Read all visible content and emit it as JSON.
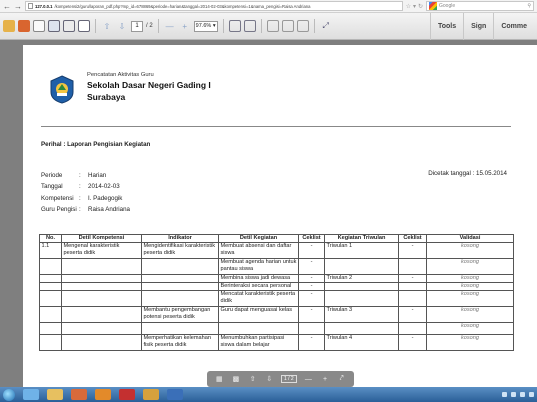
{
  "browser": {
    "url_host": "127.0.0.1",
    "url_path": "/kompetensi2/guru/laporan_pdf.php?mp_id=678869&periode=harian&tanggal=2014-02-03&kompetensi=1&nama_pengisi=Raisa Andriana",
    "search_placeholder": "Google"
  },
  "pdf_toolbar": {
    "page_current": "1",
    "page_total": "/ 2",
    "zoom": "97.6%",
    "tabs": [
      "Tools",
      "Sign",
      "Comme"
    ]
  },
  "document": {
    "header": {
      "line1": "Pencatatan Aktivitas Guru",
      "school": "Sekolah Dasar Negeri Gading I",
      "city": "Surabaya"
    },
    "perihal": "Perihal : Laporan Pengisian Kegiatan",
    "meta": [
      {
        "label": "Periode",
        "value": "Harian"
      },
      {
        "label": "Tanggal",
        "value": "2014-02-03"
      },
      {
        "label": "Kompetensi",
        "value": "I. Padegogik"
      },
      {
        "label": "Guru Pengisi",
        "value": "Raisa Andriana"
      }
    ],
    "colon": ":",
    "dicetak": "Dicetak tanggal : 15.05.2014",
    "table": {
      "headers": [
        "No.",
        "Detil Kompetensi",
        "Indikator",
        "Detil Kegiatan",
        "Ceklist",
        "Kegiatan Triwulan",
        "Ceklist",
        "Validasi"
      ],
      "rows": [
        [
          "1.1",
          "Mengenal karakteristik peserta didik",
          "Mengidentifikasi karakteristik peserta didik",
          "Membuat absensi dan daftar siswa",
          "-",
          "Triwulan 1",
          "-",
          "kosong"
        ],
        [
          "",
          "",
          "",
          "Membuat agenda harian untuk pantau siswa",
          "-",
          "",
          "",
          "kosong"
        ],
        [
          "",
          "",
          "",
          "Membina siswa jadi dewasa",
          "-",
          "Triwulan 2",
          "-",
          "kosong"
        ],
        [
          "",
          "",
          "",
          "Berinteraksi secara personal",
          "-",
          "",
          "",
          "kosong"
        ],
        [
          "",
          "",
          "",
          "Mencatat karakteristik peserta didik",
          "-",
          "",
          "",
          "kosong"
        ],
        [
          "",
          "",
          "Membantu pengembangan potensi peserta didik",
          "Guru dapat menguasai kelas",
          "-",
          "Triwulan 3",
          "-",
          "kosong"
        ],
        [
          "",
          "",
          "",
          "",
          "",
          "",
          "",
          "kosong"
        ],
        [
          "",
          "",
          "Memperhatikan kelemahan fisik peserta didik",
          "Menumbuhkan partisipasi siswa dalam belajar",
          "-",
          "Triwulan 4",
          "-",
          "kosong"
        ]
      ]
    }
  },
  "float_nav": {
    "page": "1 / 2"
  },
  "colors": {
    "page_bg": "#7f7f7f",
    "taskbar": "#2a5f98"
  }
}
